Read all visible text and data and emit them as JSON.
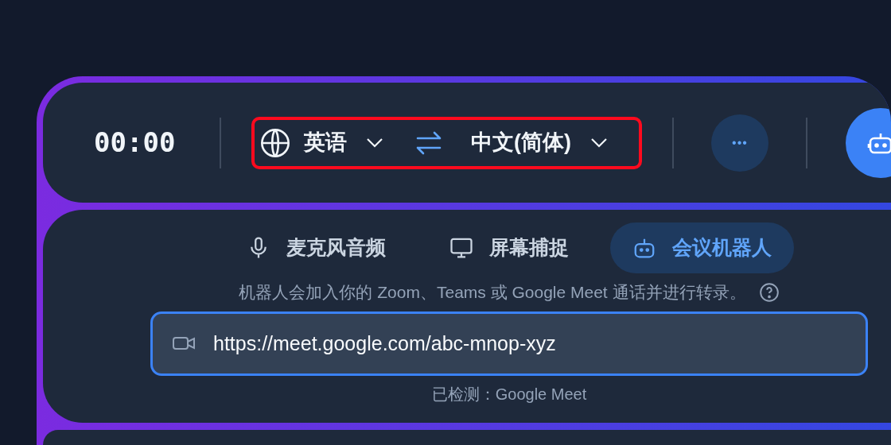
{
  "header": {
    "timer": "00:00",
    "source_language": "英语",
    "target_language": "中文(简体)",
    "more_label": "•••"
  },
  "source_tabs": [
    {
      "label": "麦克风音频",
      "kind": "mic",
      "selected": false
    },
    {
      "label": "屏幕捕捉",
      "kind": "screen",
      "selected": false
    },
    {
      "label": "会议机器人",
      "kind": "bot",
      "selected": true
    }
  ],
  "description": "机器人会加入你的 Zoom、Teams 或 Google Meet 通话并进行转录。",
  "meeting_url": {
    "value": "https://meet.google.com/abc-mnop-xyz"
  },
  "detected": "已检测：Google Meet"
}
